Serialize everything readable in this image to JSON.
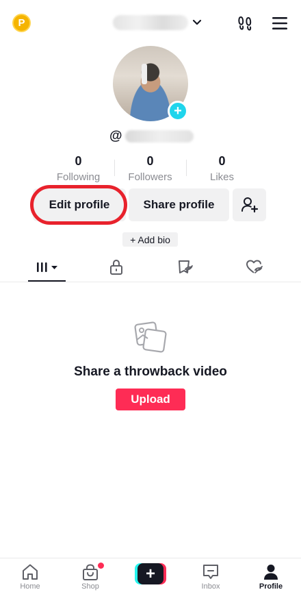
{
  "header": {
    "coin_label": "P",
    "icons": [
      "coin-icon",
      "chevron-down-icon",
      "footprint-icon",
      "menu-icon"
    ]
  },
  "profile": {
    "handle_prefix": "@",
    "stats": [
      {
        "value": "0",
        "label": "Following"
      },
      {
        "value": "0",
        "label": "Followers"
      },
      {
        "value": "0",
        "label": "Likes"
      }
    ],
    "edit_label": "Edit profile",
    "share_label": "Share profile",
    "bio_label": "+ Add bio"
  },
  "tabs": [
    "videos-grid-icon",
    "lock-icon",
    "repost-icon",
    "liked-hidden-icon"
  ],
  "empty_state": {
    "title": "Share a throwback video",
    "button_label": "Upload"
  },
  "bottom_nav": [
    {
      "label": "Home",
      "icon": "home-icon"
    },
    {
      "label": "Shop",
      "icon": "shop-bag-icon"
    },
    {
      "label": "",
      "icon": "create-plus-icon"
    },
    {
      "label": "Inbox",
      "icon": "inbox-icon"
    },
    {
      "label": "Profile",
      "icon": "profile-icon"
    }
  ],
  "colors": {
    "accent_pink": "#fe2c55",
    "accent_cyan": "#20d5ec",
    "highlight_red": "#e8222c",
    "button_gray": "#f1f1f2"
  }
}
